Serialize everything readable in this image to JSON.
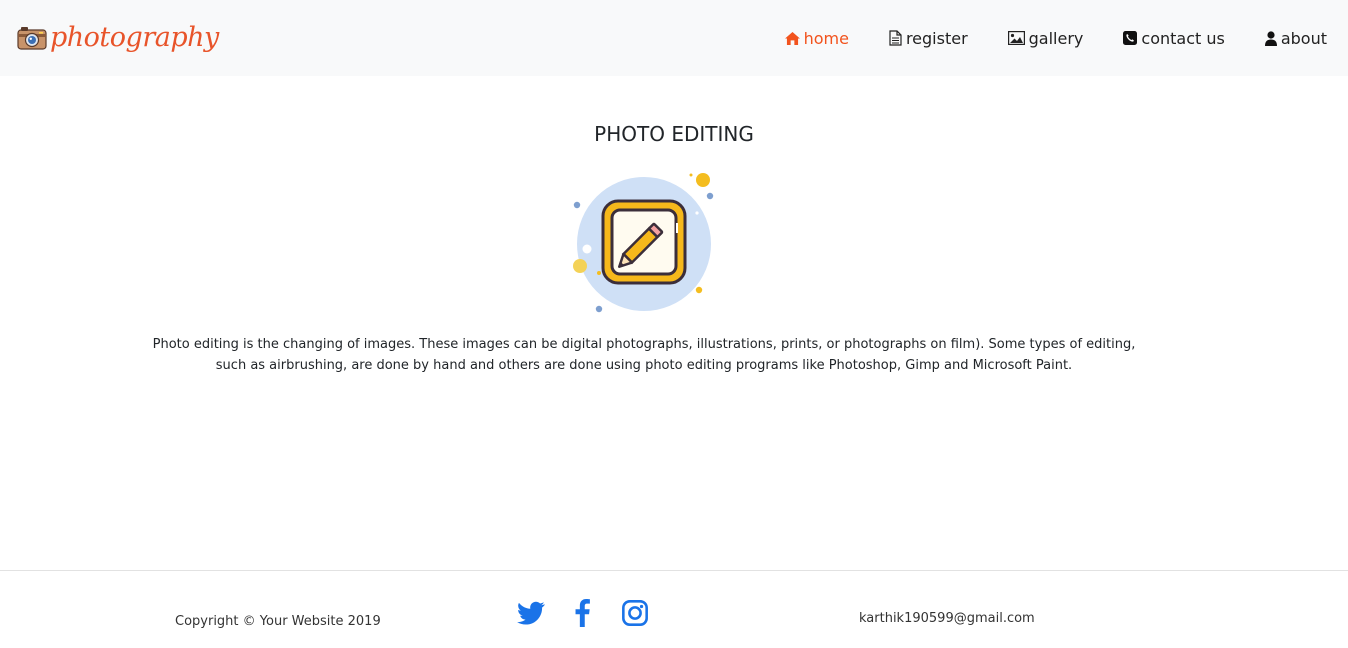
{
  "brand": {
    "name": "photography",
    "icon": "camera-icon",
    "color": "#e8542a"
  },
  "nav": {
    "active_color": "#f2531d",
    "items": [
      {
        "label": "home",
        "icon": "home-icon"
      },
      {
        "label": "register",
        "icon": "document-icon"
      },
      {
        "label": "gallery",
        "icon": "image-icon"
      },
      {
        "label": "contact us",
        "icon": "phone-icon"
      },
      {
        "label": "about",
        "icon": "user-icon"
      }
    ]
  },
  "main": {
    "title": "PHOTO EDITING",
    "illustration": "pencil-edit-icon",
    "description": "Photo editing is the changing of images. These images can be digital photographs, illustrations, prints, or photographs on film). Some types of editing, such as airbrushing, are done by hand and others are done using photo editing programs like Photoshop, Gimp and Microsoft Paint."
  },
  "footer": {
    "copyright": "Copyright © Your Website 2019",
    "socials": [
      "twitter-icon",
      "facebook-icon",
      "instagram-icon"
    ],
    "social_color": "#1a73e8",
    "email": "karthik190599@gmail.com"
  }
}
